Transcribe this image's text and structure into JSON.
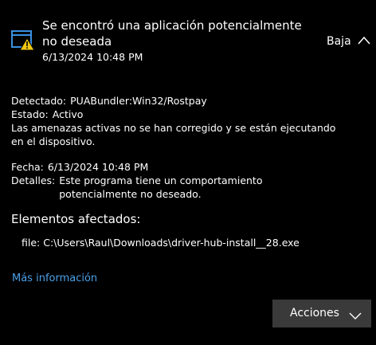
{
  "notification": {
    "title": "Se encontró una aplicación potencialmente no deseada",
    "timestamp": "6/13/2024 10:48 PM",
    "severity": "Baja",
    "icon": "threat-warning-icon"
  },
  "details": {
    "detected_label": "Detectado:",
    "detected_value": "PUABundler:Win32/Rostpay",
    "status_label": "Estado:",
    "status_value": "Activo",
    "status_message": "Las amenazas activas no se han corregido y se están ejecutando en el dispositivo.",
    "date_label": "Fecha:",
    "date_value": "6/13/2024 10:48 PM",
    "details_label": "Detalles:",
    "details_value": "Este programa tiene un comportamiento potencialmente no deseado."
  },
  "affected": {
    "title": "Elementos afectados:",
    "file": "file: C:\\Users\\Raul\\Downloads\\driver-hub-install__28.exe"
  },
  "links": {
    "more_info": "Más información"
  },
  "actions": {
    "label": "Acciones"
  },
  "colors": {
    "background": "#000000",
    "link": "#4ba0e8",
    "button": "#3a3a3a",
    "warning": "#f2c811",
    "icon_blue": "#3a8fe0"
  }
}
